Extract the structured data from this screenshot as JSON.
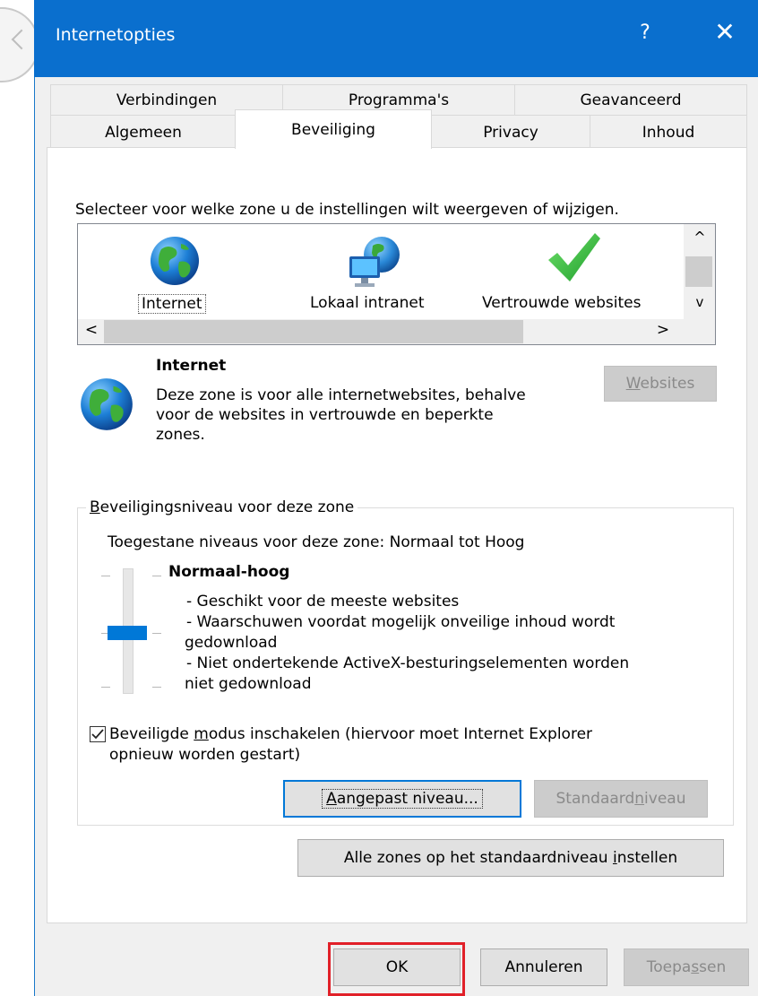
{
  "window": {
    "title": "Internetopties",
    "help_glyph": "?",
    "close_glyph": "✕"
  },
  "tabs": {
    "row1": [
      "Verbindingen",
      "Programma's",
      "Geavanceerd"
    ],
    "row2": [
      "Algemeen",
      "Beveiliging",
      "Privacy",
      "Inhoud"
    ],
    "active": "Beveiliging"
  },
  "zones": {
    "instruction": "Selecteer voor welke zone u de instellingen wilt weergeven of wijzigen.",
    "items": [
      {
        "label": "Internet",
        "icon": "globe-icon",
        "selected": true
      },
      {
        "label": "Lokaal intranet",
        "icon": "network-globe-icon",
        "selected": false
      },
      {
        "label": "Vertrouwde websites",
        "icon": "checkmark-icon",
        "selected": false
      }
    ],
    "scroll_up": "^",
    "scroll_down": "v",
    "scroll_left": "<",
    "scroll_right": ">"
  },
  "zone_info": {
    "name": "Internet",
    "description_lines": [
      "Deze zone is voor alle internetwebsites, behalve",
      "voor de websites in vertrouwde en beperkte",
      "zones."
    ],
    "websites_button": {
      "pre": "",
      "u": "W",
      "post": "ebsites"
    }
  },
  "security_level": {
    "legend": {
      "pre": "",
      "u": "B",
      "post": "eveiligingsniveau voor deze zone"
    },
    "allowed": "Toegestane niveaus voor deze zone: Normaal tot Hoog",
    "level_name": "Normaal-hoog",
    "lines": [
      "- Geschikt voor de meeste websites",
      "- Waarschuwen voordat mogelijk onveilige inhoud wordt",
      "gedownload",
      "- Niet ondertekende ActiveX-besturingselementen worden",
      "niet gedownload"
    ],
    "slider_position": "3 of 4"
  },
  "protected_mode": {
    "checked": true,
    "label_line1": {
      "pre": "Beveiligde ",
      "u": "m",
      "post": "odus inschakelen (hiervoor moet Internet Explorer"
    },
    "label_line2": "opnieuw worden gestart)"
  },
  "buttons": {
    "custom_level": {
      "pre": "",
      "u": "A",
      "post": "angepast niveau..."
    },
    "default_level": {
      "pre": "Standaard",
      "u": "n",
      "post": "iveau"
    },
    "reset_all": {
      "pre": "Alle zones op het standaardniveau ",
      "u": "i",
      "post": "nstellen"
    },
    "ok": "OK",
    "cancel": "Annuleren",
    "apply": {
      "pre": "Toepa",
      "u": "s",
      "post": "sen"
    }
  },
  "colors": {
    "titlebar": "#0a6fce",
    "accent": "#0078d7",
    "highlight": "#e12028"
  }
}
